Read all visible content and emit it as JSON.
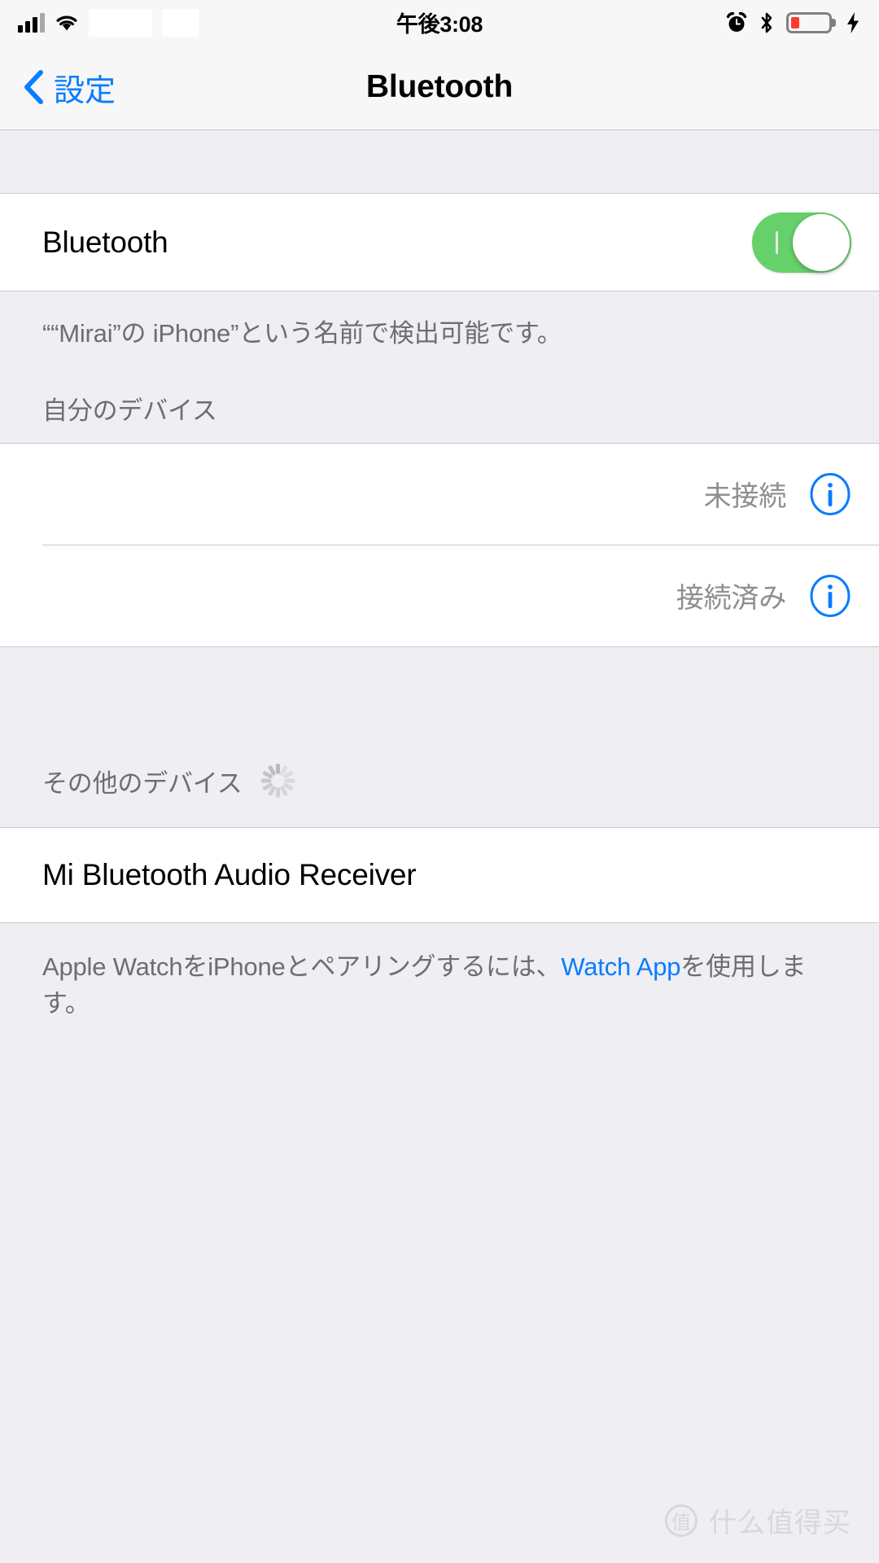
{
  "status_bar": {
    "time": "午後3:08",
    "signal_icon": "cellular-signal-icon",
    "wifi_icon": "wifi-icon",
    "alarm_icon": "alarm-clock-icon",
    "bluetooth_icon": "bluetooth-icon",
    "battery_icon": "battery-low-icon",
    "battery_level_percent": 22,
    "charging_icon": "lightning-bolt-icon",
    "battery_color": "#FF3B30"
  },
  "nav_bar": {
    "back_label": "設定",
    "back_icon": "chevron-left-icon",
    "title": "Bluetooth",
    "tint_color": "#0A7CFF"
  },
  "bluetooth_toggle": {
    "label": "Bluetooth",
    "state": "on",
    "on_color": "#66D06A"
  },
  "discoverable_note": "““Mirai”の iPhone”という名前で検出可能です。",
  "my_devices": {
    "header": "自分のデバイス",
    "rows": [
      {
        "name": "",
        "status": "未接続",
        "info_icon": "info-circle-icon"
      },
      {
        "name": "",
        "status": "接続済み",
        "info_icon": "info-circle-icon"
      }
    ]
  },
  "other_devices": {
    "header": "その他のデバイス",
    "spinner_icon": "activity-spinner-icon",
    "rows": [
      {
        "name": "Mi Bluetooth Audio Receiver"
      }
    ]
  },
  "footer": {
    "text_before": "Apple WatchをiPhoneとペアリングするには、",
    "link_text": "Watch App",
    "text_after": "を使用します。"
  },
  "watermark": {
    "logo_char": "值",
    "text": "什么值得买"
  }
}
